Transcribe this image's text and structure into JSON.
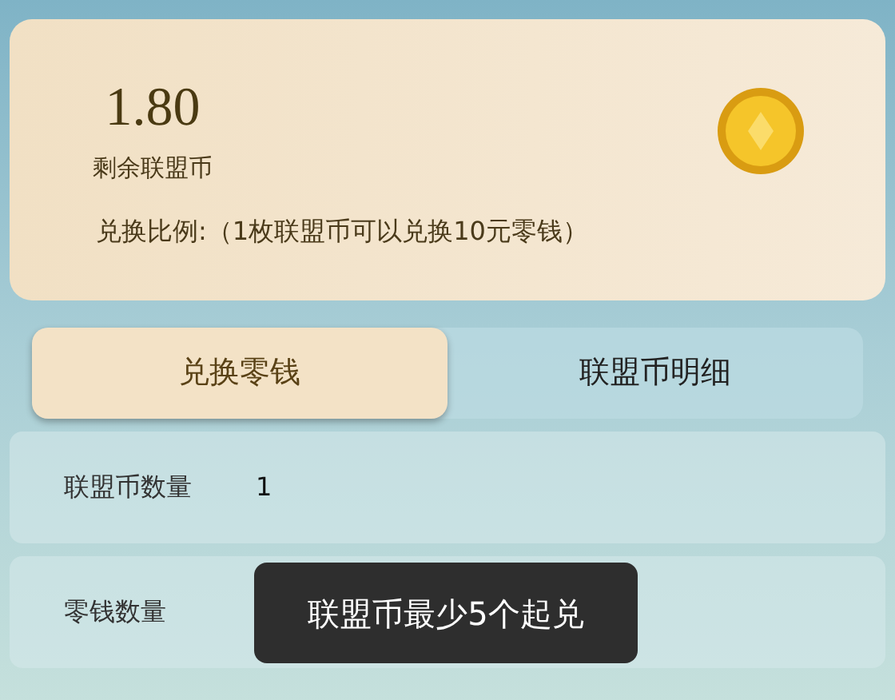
{
  "balance": {
    "amount": "1.80",
    "label": "剩余联盟币",
    "ratio": "兑换比例:（1枚联盟币可以兑换10元零钱）"
  },
  "tabs": [
    {
      "label": "兑换零钱",
      "selected": true
    },
    {
      "label": "联盟币明细",
      "selected": false
    }
  ],
  "fields": [
    {
      "label": "联盟币数量",
      "value": "1"
    },
    {
      "label": "零钱数量"
    }
  ],
  "toast": "联盟币最少5个起兑"
}
